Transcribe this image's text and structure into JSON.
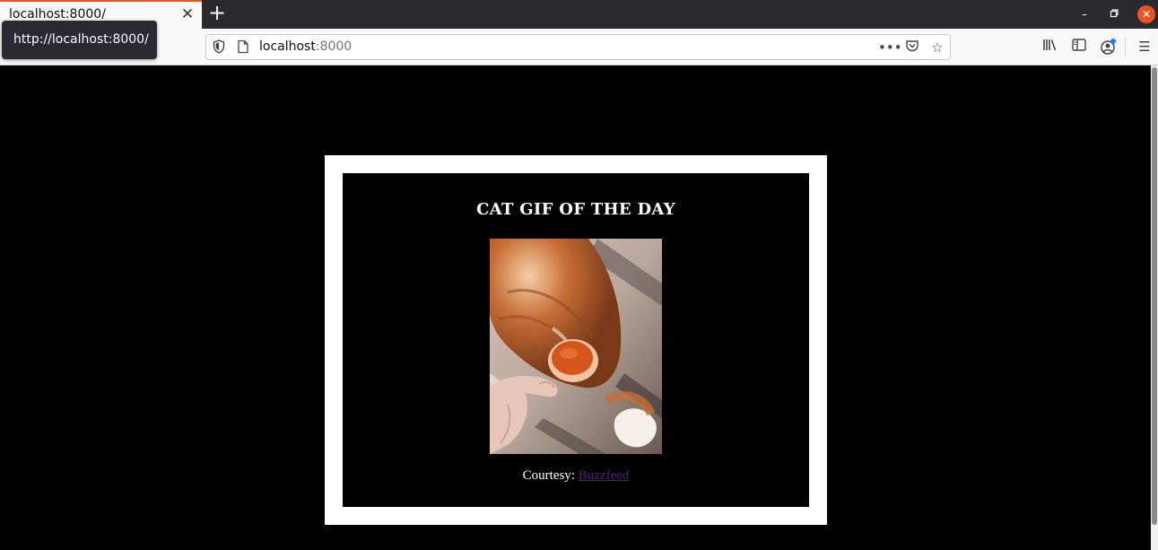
{
  "tab": {
    "title": "localhost:8000/"
  },
  "tooltip": {
    "text": "http://localhost:8000/"
  },
  "urlbar": {
    "host": "localhost",
    "port": ":8000"
  },
  "page": {
    "heading": "CAT GIF OF THE DAY",
    "courtesy_label": "Courtesy: ",
    "courtesy_link": "Buzzfeed",
    "image_alt": "Orange cat licking a treat held by a hand"
  },
  "colors": {
    "accent": "#e95420",
    "link": "#551a8b"
  },
  "icons": {
    "tab_close": "close-icon",
    "new_tab": "plus-icon",
    "menu": "hamburger-icon"
  }
}
